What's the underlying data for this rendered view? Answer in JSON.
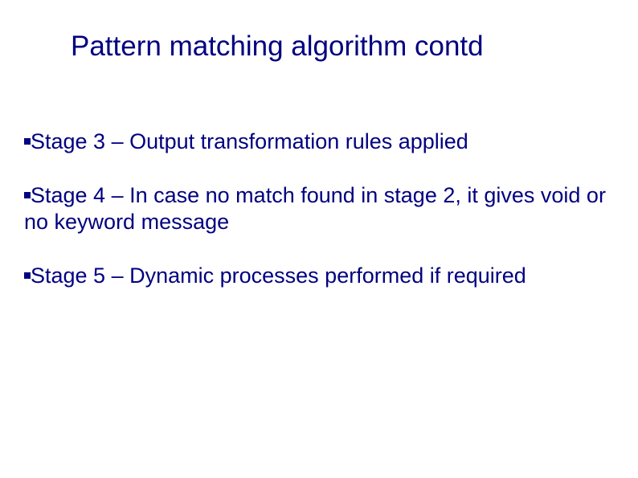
{
  "title": "Pattern matching algorithm contd",
  "bullets": [
    {
      "text": "Stage 3 – Output transformation rules applied"
    },
    {
      "text": "Stage 4 – In case no match found in stage 2, it gives void or no keyword message"
    },
    {
      "text": "Stage 5 – Dynamic processes performed if required"
    }
  ]
}
